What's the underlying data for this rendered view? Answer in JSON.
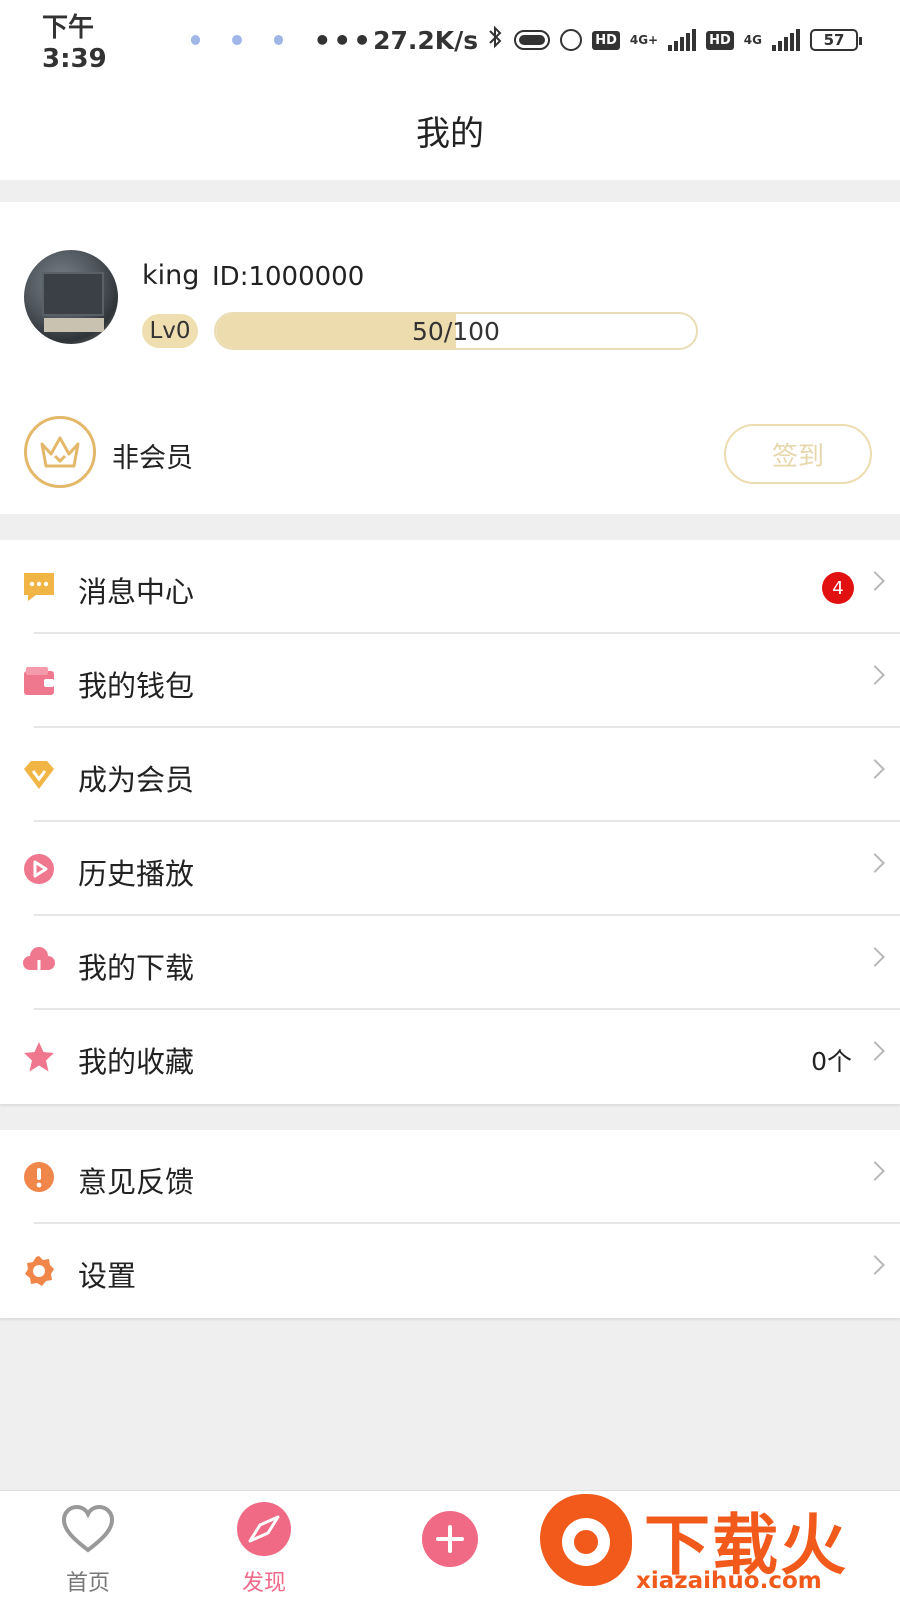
{
  "status_bar": {
    "time": "下午3:39",
    "more": "•••",
    "speed": "27.2K/s",
    "hd_1": "HD",
    "net_1": "4G+",
    "hd_2": "HD",
    "net_2": "4G",
    "battery": "57"
  },
  "header": {
    "title": "我的"
  },
  "profile": {
    "username": "king",
    "user_id": "ID:1000000",
    "level": "Lv0",
    "progress_text": "50/100",
    "progress_fraction": 0.5,
    "member_status": "非会员",
    "checkin_label": "签到"
  },
  "menu": {
    "items": [
      {
        "label": "消息中心",
        "icon": "message-icon",
        "badge": "4",
        "color": "#f0b545"
      },
      {
        "label": "我的钱包",
        "icon": "wallet-icon",
        "color": "#f0788e"
      },
      {
        "label": "成为会员",
        "icon": "vip-diamond-icon",
        "color": "#f0b545"
      },
      {
        "label": "历史播放",
        "icon": "play-history-icon",
        "color": "#f0788e"
      },
      {
        "label": "我的下载",
        "icon": "download-cloud-icon",
        "color": "#f0788e"
      },
      {
        "label": "我的收藏",
        "icon": "star-icon",
        "value": "0个",
        "color": "#f0788e"
      }
    ],
    "secondary": [
      {
        "label": "意见反馈",
        "icon": "feedback-icon",
        "color": "#f0864a"
      },
      {
        "label": "设置",
        "icon": "settings-gear-icon",
        "color": "#f0864a"
      }
    ]
  },
  "bottom_nav": {
    "items": [
      {
        "label": "首页",
        "icon": "heart-icon",
        "active": false
      },
      {
        "label": "发现",
        "icon": "compass-icon",
        "active": true
      }
    ],
    "add_icon": "plus-icon"
  },
  "watermark": {
    "title": "下载火",
    "url": "xiazaihuo.com"
  },
  "colors": {
    "accent_pink": "#f06a86",
    "gold": "#e3b86a",
    "badge_red": "#e21111",
    "watermark_orange": "#f25a1c"
  }
}
